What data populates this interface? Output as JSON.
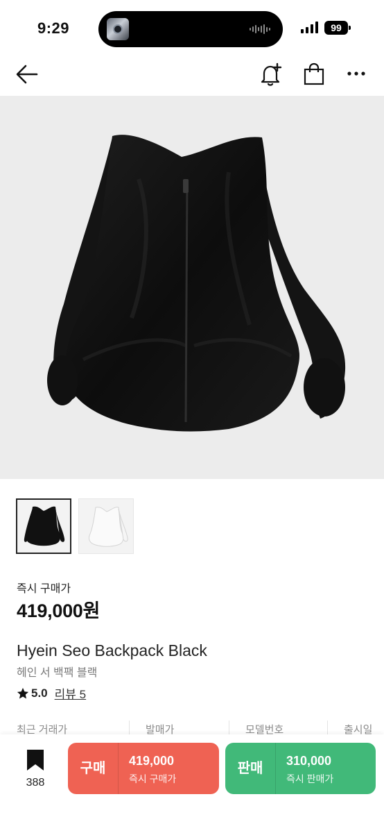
{
  "status_bar": {
    "time": "9:29",
    "battery": "99"
  },
  "product": {
    "instant_buy_label": "즉시 구매가",
    "price": "419,000원",
    "name_en": "Hyein Seo Backpack Black",
    "name_ko": "헤인 서 백팩 블랙",
    "rating": "5.0",
    "review_label": "리뷰 5",
    "thumbnails": [
      "Black",
      "White"
    ]
  },
  "info_row": {
    "labels": [
      "최근 거래가",
      "발매가",
      "모델번호",
      "출시일"
    ]
  },
  "bottom_bar": {
    "wish_count": "388",
    "buy": {
      "label": "구매",
      "price": "419,000",
      "sub": "즉시 구매가",
      "color": "#ef6253"
    },
    "sell": {
      "label": "판매",
      "price": "310,000",
      "sub": "즉시 판매가",
      "color": "#41b979"
    }
  },
  "icons": [
    "back-arrow-icon",
    "bell-plus-icon",
    "shopping-bag-icon",
    "more-icon",
    "star-icon",
    "bookmark-icon"
  ]
}
